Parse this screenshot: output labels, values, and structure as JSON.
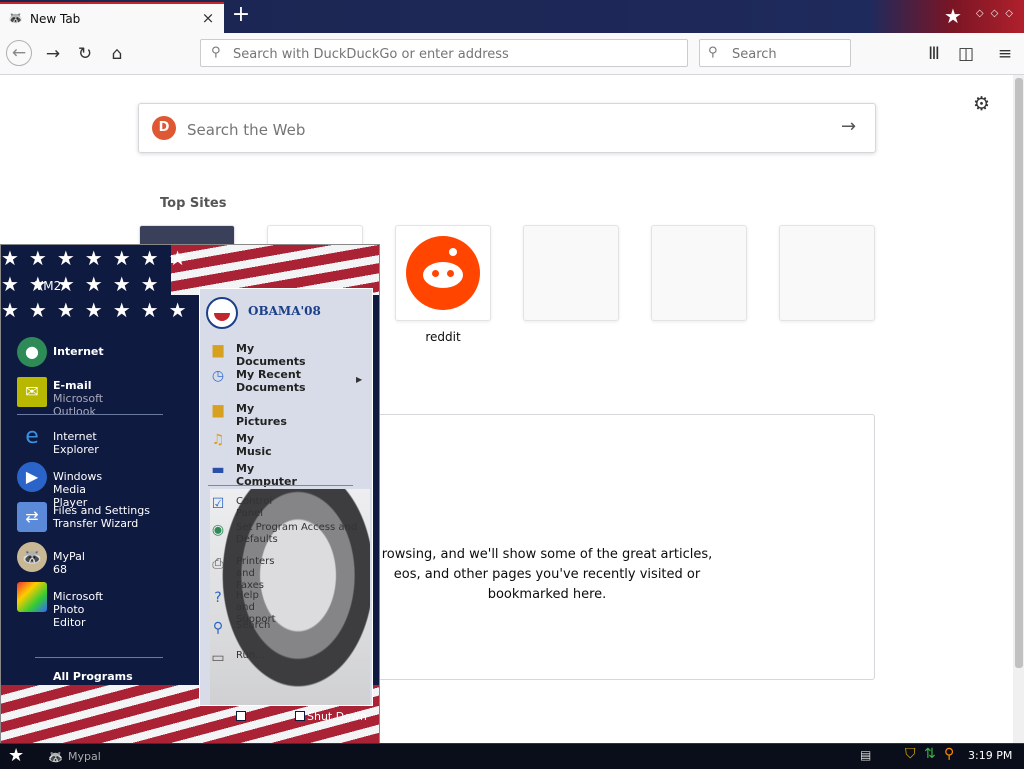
{
  "browser": {
    "tab": {
      "title": "New Tab",
      "close_icon": "×"
    },
    "new_tab_icon": "+",
    "url_placeholder": "Search with DuckDuckGo or enter address",
    "search_placeholder": "Search"
  },
  "newtab": {
    "web_search_placeholder": "Search the Web",
    "top_sites_title": "Top Sites",
    "tiles": [
      {
        "label": ""
      },
      {
        "label": ""
      },
      {
        "label": "reddit"
      },
      {
        "label": ""
      },
      {
        "label": ""
      },
      {
        "label": ""
      }
    ],
    "highlights_text": "rowsing, and we'll show some of the great articles, eos, and other pages you've recently visited or bookmarked here.",
    "highlights_lines": [
      "rowsing, and we'll show some of the great articles,",
      "eos, and other pages you've recently visited or",
      "bookmarked here."
    ]
  },
  "start_menu": {
    "username": "VM2",
    "pinned": [
      {
        "label": "Internet",
        "sub": "",
        "icon": "globe-icon"
      },
      {
        "label": "E-mail",
        "sub": "Microsoft Outlook",
        "icon": "outlook-icon"
      }
    ],
    "recent": [
      {
        "label": "Internet Explorer",
        "icon": "ie-icon"
      },
      {
        "label": "Windows Media Player",
        "icon": "media-player-icon"
      },
      {
        "label": "Files and Settings Transfer Wizard",
        "icon": "transfer-wizard-icon"
      },
      {
        "label": "MyPal 68",
        "icon": "mypal-icon"
      },
      {
        "label": "Microsoft Photo Editor",
        "icon": "photo-editor-icon"
      }
    ],
    "all_programs": "All Programs",
    "right_header": "OBAMA'08",
    "right_items": [
      {
        "label": "My Documents"
      },
      {
        "label": "My Recent Documents"
      },
      {
        "label": "My Pictures"
      },
      {
        "label": "My Music"
      },
      {
        "label": "My Computer"
      }
    ],
    "right_items_lower": [
      {
        "label": "Control Panel"
      },
      {
        "label": "Set Program Access and Defaults"
      },
      {
        "label": "Printers and Faxes"
      },
      {
        "label": "Help and Support"
      },
      {
        "label": "Search"
      },
      {
        "label": "Run..."
      }
    ],
    "shutdown": "Shut Down"
  },
  "taskbar": {
    "item": "Mypal",
    "clock": "3:19 PM"
  }
}
